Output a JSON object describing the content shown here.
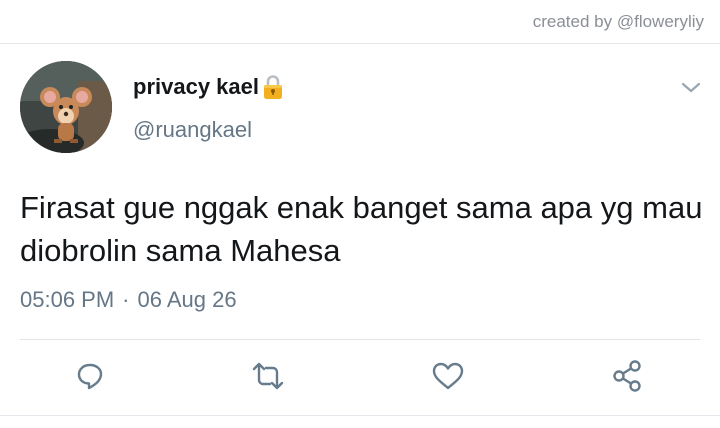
{
  "header": {
    "credit_text": "created by @floweryliy"
  },
  "author": {
    "display_name": "privacy kael",
    "handle": "@ruangkael"
  },
  "tweet": {
    "text": "Firasat gue nggak enak banget sama apa yg mau diobrolin sama Mahesa",
    "time": "05:06 PM",
    "separator": "·",
    "date": "06 Aug 26"
  },
  "icons": {
    "lock": "lock-icon",
    "more": "chevron-down-icon",
    "reply": "reply-icon",
    "retweet": "retweet-icon",
    "like": "heart-icon",
    "share": "share-icon"
  },
  "colors": {
    "text": "#14171a",
    "secondary": "#657786",
    "icon": "#667b8b",
    "lock": "#f2b01e"
  }
}
